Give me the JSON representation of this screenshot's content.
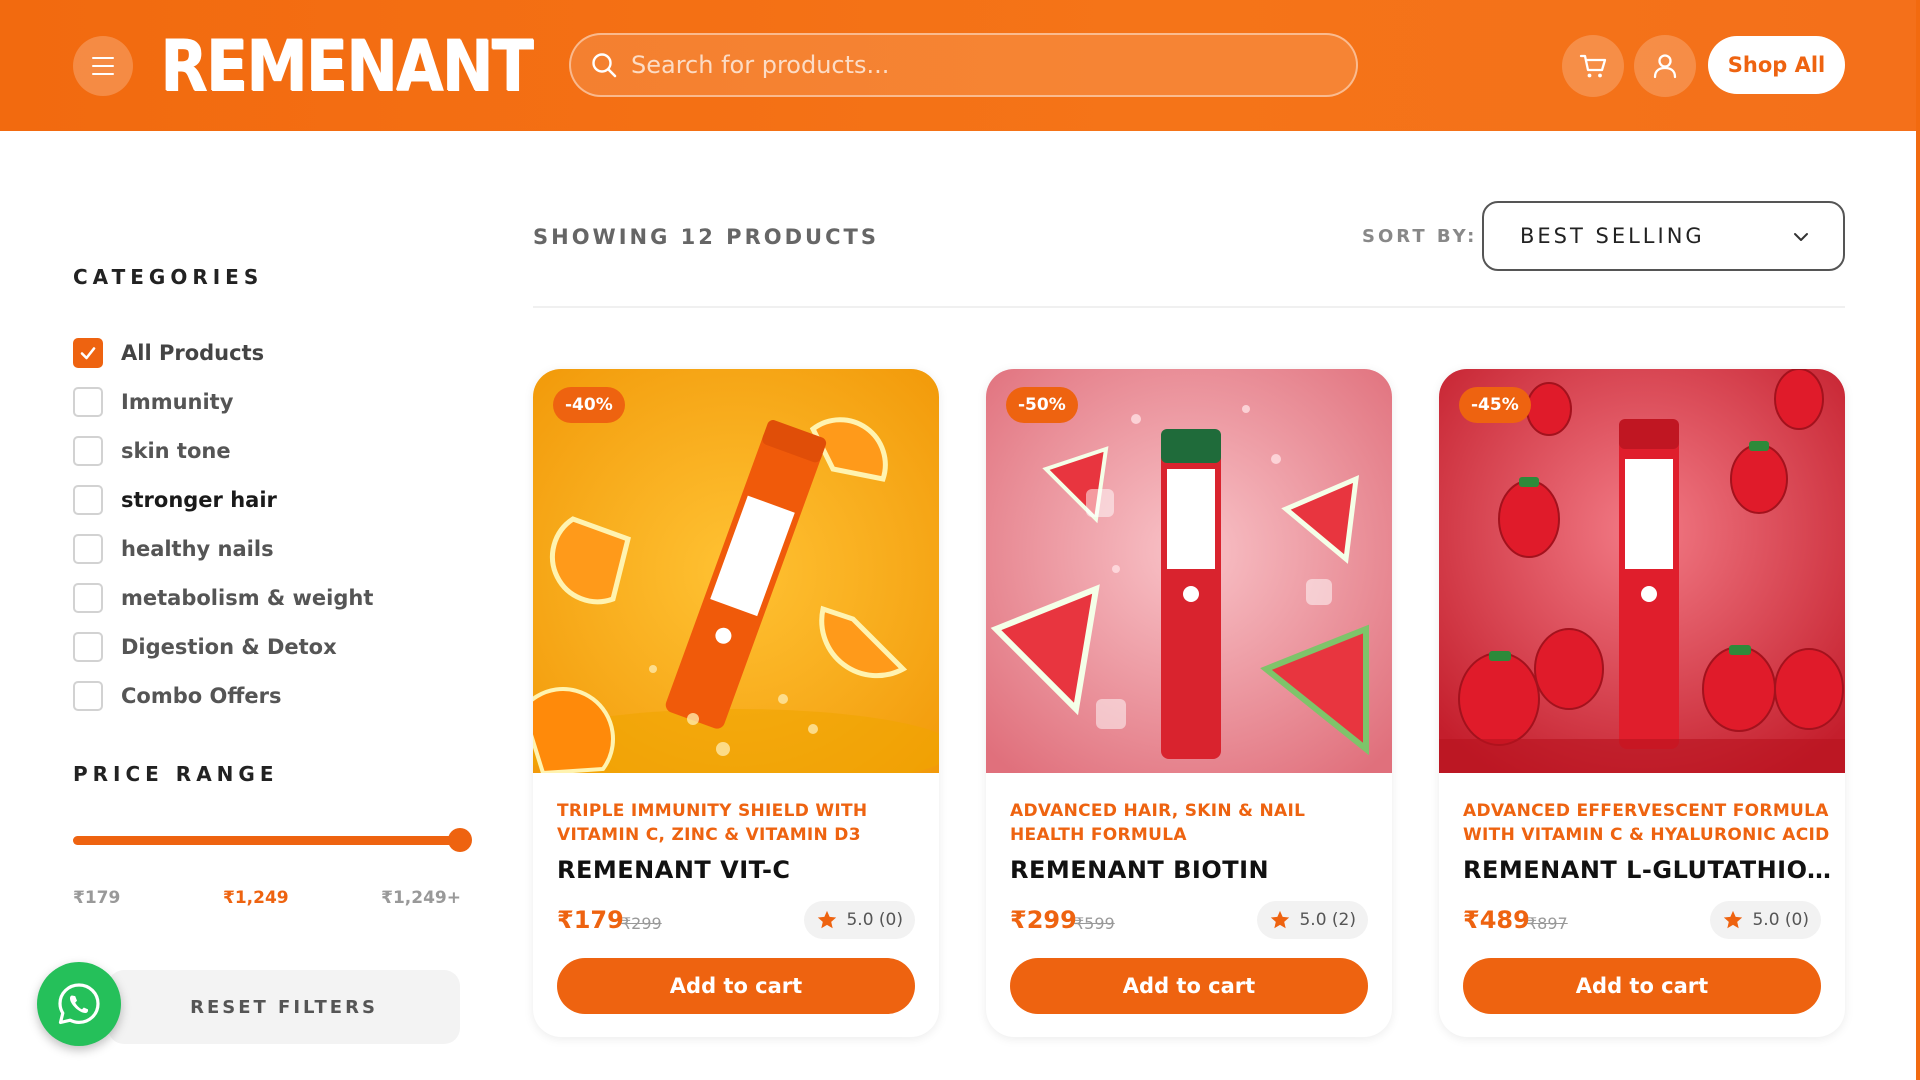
{
  "header": {
    "logo": "REMENANT",
    "search_placeholder": "Search for products...",
    "shop_all": "Shop All"
  },
  "sidebar": {
    "categories_title": "CATEGORIES",
    "categories": [
      {
        "label": "All Products",
        "checked": true
      },
      {
        "label": "Immunity",
        "checked": false
      },
      {
        "label": "skin tone",
        "checked": false
      },
      {
        "label": "stronger hair",
        "checked": false
      },
      {
        "label": "healthy nails",
        "checked": false
      },
      {
        "label": "metabolism & weight",
        "checked": false
      },
      {
        "label": "Digestion & Detox",
        "checked": false
      },
      {
        "label": "Combo Offers",
        "checked": false
      }
    ],
    "price_title": "PRICE RANGE",
    "price_min": "₹179",
    "price_current": "₹1,249",
    "price_max": "₹1,249+",
    "slider_fraction": 1.0,
    "reset_label": "RESET FILTERS"
  },
  "main": {
    "showing": "SHOWING 12 PRODUCTS",
    "sort_label": "SORT BY:",
    "sort_value": "BEST SELLING",
    "products": [
      {
        "badge": "-40%",
        "tagline": "TRIPLE IMMUNITY SHIELD WITH VITAMIN C, ZINC & VITAMIN D3",
        "name": "REMENANT VIT-C",
        "price": "₹179",
        "mrp": "₹299",
        "rating": "5.0 (0)",
        "add_label": "Add to cart"
      },
      {
        "badge": "-50%",
        "tagline": "ADVANCED HAIR, SKIN & NAIL HEALTH FORMULA",
        "name": "REMENANT BIOTIN",
        "price": "₹299",
        "mrp": "₹599",
        "rating": "5.0 (2)",
        "add_label": "Add to cart"
      },
      {
        "badge": "-45%",
        "tagline": "ADVANCED EFFERVESCENT FORMULA WITH VITAMIN C & HYALURONIC ACID",
        "name": "REMENANT L-GLUTATHIO...",
        "price": "₹489",
        "mrp": "₹897",
        "rating": "5.0 (0)",
        "add_label": "Add to cart"
      }
    ]
  },
  "colors": {
    "brand_orange": "#ee6310",
    "whatsapp_green": "#25c05a"
  }
}
